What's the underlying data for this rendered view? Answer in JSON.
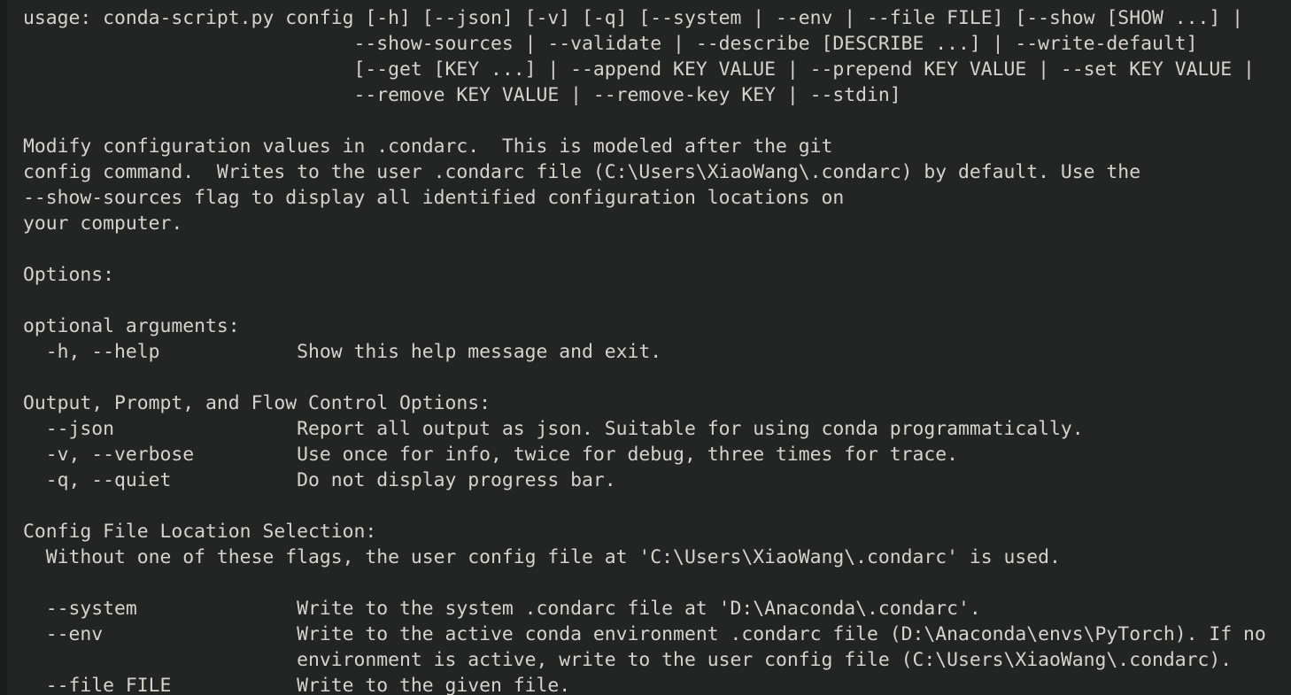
{
  "terminal": {
    "background_color": "#232424",
    "gutter_color": "#1c1d1d",
    "text_color": "#d6d3cd",
    "program": "conda-script.py config",
    "lines": [
      "usage: conda-script.py config [-h] [--json] [-v] [-q] [--system | --env | --file FILE] [--show [SHOW ...] |",
      "                             --show-sources | --validate | --describe [DESCRIBE ...] | --write-default]",
      "                             [--get [KEY ...] | --append KEY VALUE | --prepend KEY VALUE | --set KEY VALUE |",
      "                             --remove KEY VALUE | --remove-key KEY | --stdin]",
      "",
      "Modify configuration values in .condarc.  This is modeled after the git",
      "config command.  Writes to the user .condarc file (C:\\Users\\XiaoWang\\.condarc) by default. Use the",
      "--show-sources flag to display all identified configuration locations on",
      "your computer.",
      "",
      "Options:",
      "",
      "optional arguments:",
      "  -h, --help            Show this help message and exit.",
      "",
      "Output, Prompt, and Flow Control Options:",
      "  --json                Report all output as json. Suitable for using conda programmatically.",
      "  -v, --verbose         Use once for info, twice for debug, three times for trace.",
      "  -q, --quiet           Do not display progress bar.",
      "",
      "Config File Location Selection:",
      "  Without one of these flags, the user config file at 'C:\\Users\\XiaoWang\\.condarc' is used.",
      "",
      "  --system              Write to the system .condarc file at 'D:\\Anaconda\\.condarc'.",
      "  --env                 Write to the active conda environment .condarc file (D:\\Anaconda\\envs\\PyTorch). If no",
      "                        environment is active, write to the user config file (C:\\Users\\XiaoWang\\.condarc).",
      "  --file FILE           Write to the given file."
    ]
  }
}
